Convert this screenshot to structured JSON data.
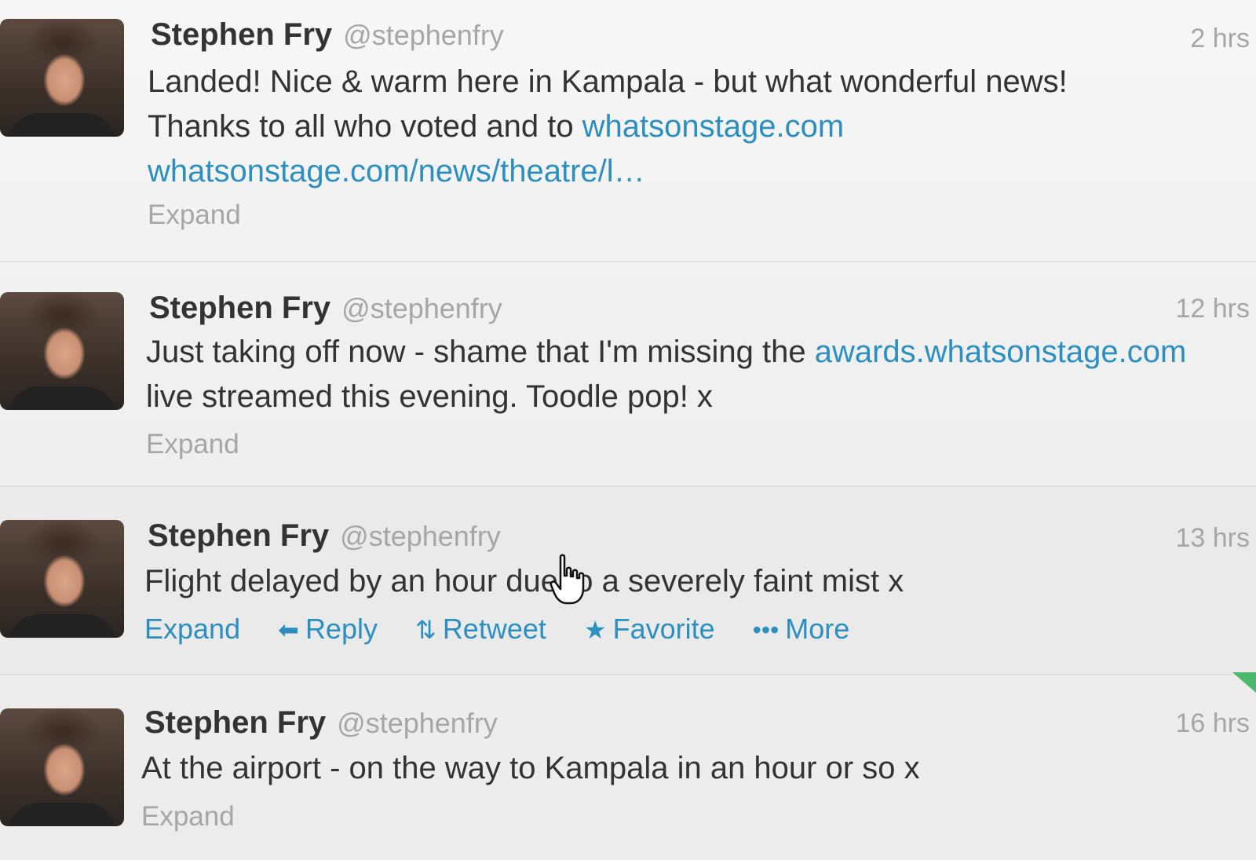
{
  "tweets": [
    {
      "name": "Stephen Fry",
      "handle": "@stephenfry",
      "time": "2 hrs",
      "text_parts": {
        "p1": "Landed! Nice & warm here in Kampala - but what wonderful news! Thanks to all who voted and to ",
        "link1": "whatsonstage.com",
        "sep": " ",
        "link2": "whatsonstage.com/news/theatre/l…"
      },
      "expand": "Expand"
    },
    {
      "name": "Stephen Fry",
      "handle": "@stephenfry",
      "time": "12 hrs",
      "text_parts": {
        "p1": "Just taking off now - shame that I'm missing the ",
        "link1": "awards.whatsonstage.com",
        "p2": " live streamed this evening. Toodle pop! x"
      },
      "expand": "Expand"
    },
    {
      "name": "Stephen Fry",
      "handle": "@stephenfry",
      "time": "13 hrs",
      "text": "Flight delayed by an hour due to a severely faint mist x",
      "expand": "Expand",
      "actions": {
        "reply": "Reply",
        "retweet": "Retweet",
        "favorite": "Favorite",
        "more": "More"
      },
      "icons": {
        "reply": "reply-arrow-icon",
        "retweet": "retweet-icon",
        "favorite": "star-icon",
        "more": "more-dots-icon"
      }
    },
    {
      "name": "Stephen Fry",
      "handle": "@stephenfry",
      "time": "16 hrs",
      "text": "At the airport - on the way to Kampala in an hour or so x",
      "expand": "Expand"
    }
  ],
  "colors": {
    "link": "#2c8fbf",
    "muted": "#a6a6a6",
    "text": "#333333",
    "corner_accent": "#4bb86b"
  }
}
